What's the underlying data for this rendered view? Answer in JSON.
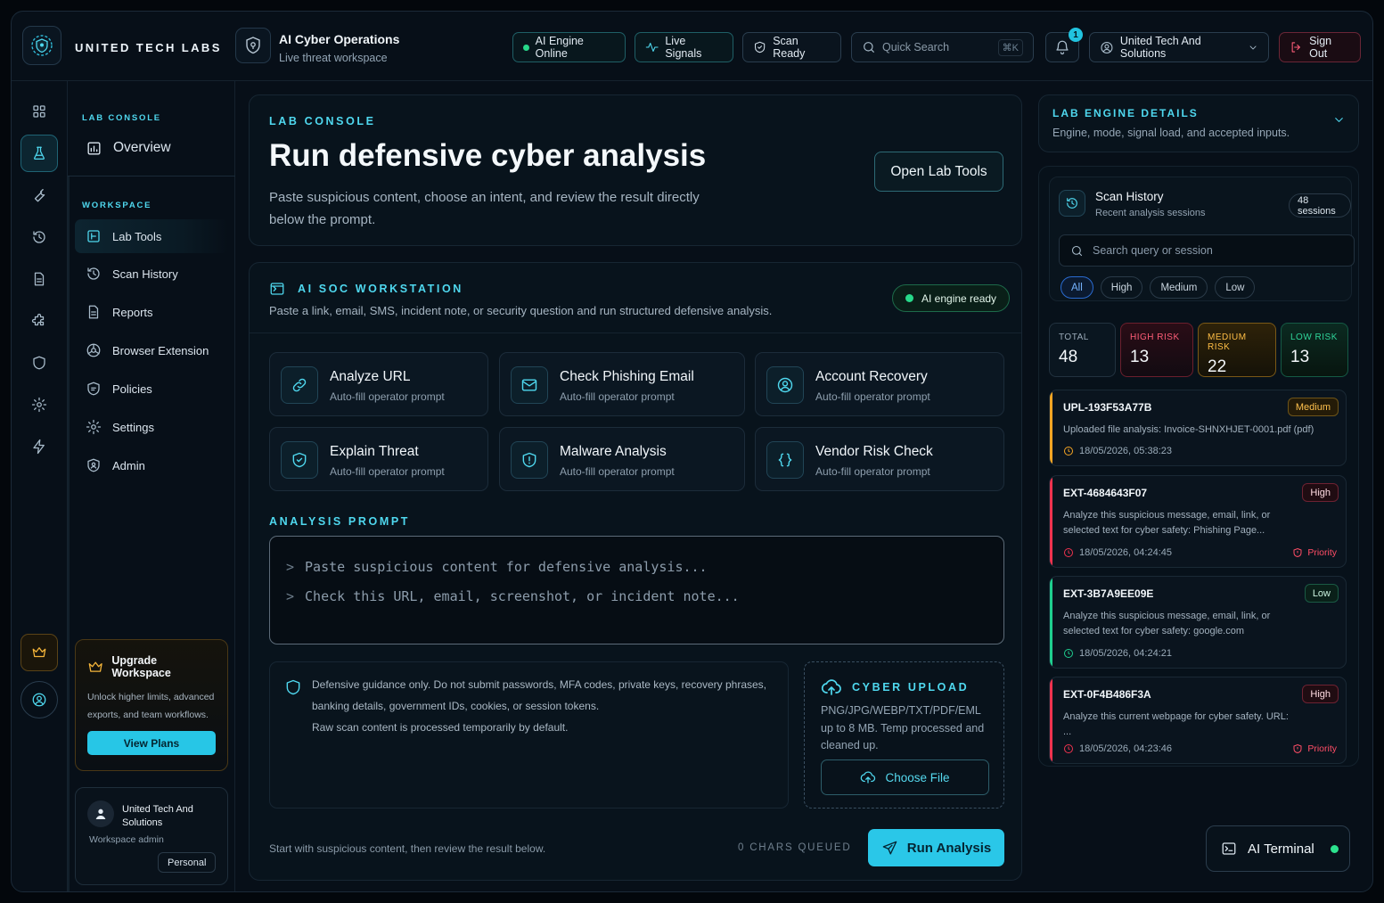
{
  "brand": {
    "name": "UNITED TECH LABS"
  },
  "workspace": {
    "title": "AI Cyber Operations",
    "subtitle": "Live threat workspace"
  },
  "header": {
    "engine_status": "AI Engine Online",
    "live_signals": "Live Signals",
    "scan_ready": "Scan Ready",
    "search_placeholder": "Quick Search",
    "search_shortcut": "⌘K",
    "notification_count": "1",
    "account_name": "United Tech And Solutions",
    "sign_out": "Sign Out"
  },
  "sidebar": {
    "console_label": "LAB CONSOLE",
    "overview": "Overview",
    "workspace_label": "WORKSPACE",
    "items": [
      "Lab Tools",
      "Scan History",
      "Reports",
      "Browser Extension",
      "Policies",
      "Settings",
      "Admin"
    ],
    "upgrade": {
      "title": "Upgrade Workspace",
      "description": "Unlock higher limits, advanced exports, and team workflows.",
      "button": "View Plans"
    },
    "user": {
      "name": "United Tech And Solutions",
      "role": "Workspace admin",
      "plan": "Personal"
    }
  },
  "hero": {
    "eyebrow": "LAB CONSOLE",
    "title": "Run defensive cyber analysis",
    "description": "Paste suspicious content, choose an intent, and review the result directly below the prompt.",
    "open_tools": "Open Lab Tools"
  },
  "workstation": {
    "title": "AI SOC WORKSTATION",
    "description": "Paste a link, email, SMS, incident note, or security question and run structured defensive analysis.",
    "status": "AI engine ready",
    "tools": [
      {
        "title": "Analyze URL",
        "sub": "Auto-fill operator prompt",
        "icon": "link-icon"
      },
      {
        "title": "Check Phishing Email",
        "sub": "Auto-fill operator prompt",
        "icon": "mail-icon"
      },
      {
        "title": "Account Recovery",
        "sub": "Auto-fill operator prompt",
        "icon": "user-circle-icon"
      },
      {
        "title": "Explain Threat",
        "sub": "Auto-fill operator prompt",
        "icon": "shield-check-icon"
      },
      {
        "title": "Malware Analysis",
        "sub": "Auto-fill operator prompt",
        "icon": "shield-alert-icon"
      },
      {
        "title": "Vendor Risk Check",
        "sub": "Auto-fill operator prompt",
        "icon": "braces-icon"
      }
    ],
    "prompt_label": "ANALYSIS PROMPT",
    "prompt_lines": [
      "Paste suspicious content for defensive analysis...",
      "Check this URL, email, screenshot, or incident note..."
    ],
    "guidance": [
      "Defensive guidance only. Do not submit passwords, MFA codes, private keys, recovery phrases,",
      "banking details, government IDs, cookies, or session tokens.",
      "Raw scan content is processed temporarily by default."
    ],
    "upload": {
      "title": "CYBER UPLOAD",
      "description": "PNG/JPG/WEBP/TXT/PDF/EML up to 8 MB. Temp processed and cleaned up.",
      "button": "Choose File"
    },
    "start_hint": "Start with suspicious content, then review the result below.",
    "chars_queued": "0 CHARS QUEUED",
    "run_button": "Run Analysis"
  },
  "right_panel": {
    "title": "LAB ENGINE DETAILS",
    "subtitle": "Engine, mode, signal load, and accepted inputs.",
    "scan_history": {
      "title": "Scan History",
      "subtitle": "Recent analysis sessions",
      "count": "48 sessions",
      "search_placeholder": "Search query or session",
      "filters": [
        "All",
        "High",
        "Medium",
        "Low"
      ],
      "active_filter": "All"
    },
    "stats": {
      "total_label": "TOTAL",
      "total": "48",
      "high_label": "HIGH RISK",
      "high": "13",
      "medium_label": "MEDIUM RISK",
      "medium": "22",
      "low_label": "LOW RISK",
      "low": "13"
    },
    "entries": [
      {
        "id": "UPL-193F53A77B",
        "risk": "Medium",
        "desc": "Uploaded file analysis: Invoice-SHNXHJET-0001.pdf (pdf)",
        "time": "18/05/2026, 05:38:23",
        "priority": ""
      },
      {
        "id": "EXT-4684643F07",
        "risk": "High",
        "desc": "Analyze this suspicious message, email, link, or selected text for cyber safety: Phishing Page...",
        "time": "18/05/2026, 04:24:45",
        "priority": "Priority"
      },
      {
        "id": "EXT-3B7A9EE09E",
        "risk": "Low",
        "desc": "Analyze this suspicious message, email, link, or selected text for cyber safety: google.com",
        "time": "18/05/2026, 04:24:21",
        "priority": ""
      },
      {
        "id": "EXT-0F4B486F3A",
        "risk": "High",
        "desc": "Analyze this current webpage for cyber safety. URL: ...",
        "time": "18/05/2026, 04:23:46",
        "priority": "Priority"
      }
    ],
    "colors": {
      "medium": "#f5a524",
      "high": "#f0334f",
      "low": "#1fcf8f"
    }
  },
  "terminal": {
    "label": "AI Terminal"
  }
}
